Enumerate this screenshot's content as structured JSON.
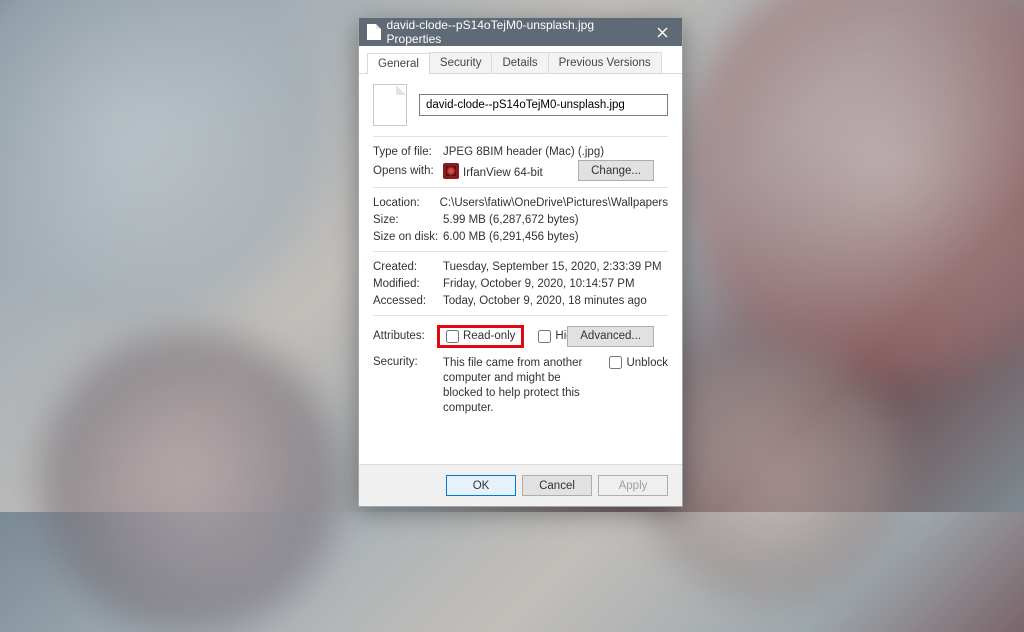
{
  "window": {
    "title": "david-clode--pS14oTejM0-unsplash.jpg Properties"
  },
  "tabs": {
    "general": "General",
    "security": "Security",
    "details": "Details",
    "previous": "Previous Versions"
  },
  "file": {
    "name": "david-clode--pS14oTejM0-unsplash.jpg"
  },
  "labels": {
    "typeoffile": "Type of file:",
    "openswith": "Opens with:",
    "change": "Change...",
    "location": "Location:",
    "size": "Size:",
    "sizeondisk": "Size on disk:",
    "created": "Created:",
    "modified": "Modified:",
    "accessed": "Accessed:",
    "attributes": "Attributes:",
    "readonly": "Read-only",
    "hidden": "Hidden",
    "advanced": "Advanced...",
    "security": "Security:",
    "unblock": "Unblock"
  },
  "values": {
    "typeoffile": "JPEG 8BIM header (Mac) (.jpg)",
    "openswith": "IrfanView 64-bit",
    "location": "C:\\Users\\fatiw\\OneDrive\\Pictures\\Wallpapers",
    "size": "5.99 MB (6,287,672 bytes)",
    "sizeondisk": "6.00 MB (6,291,456 bytes)",
    "created": "Tuesday, September 15, 2020, 2:33:39 PM",
    "modified": "Friday, October 9, 2020, 10:14:57 PM",
    "accessed": "Today, October 9, 2020, 18 minutes ago",
    "securitytext": "This file came from another computer and might be blocked to help protect this computer."
  },
  "buttons": {
    "ok": "OK",
    "cancel": "Cancel",
    "apply": "Apply"
  }
}
